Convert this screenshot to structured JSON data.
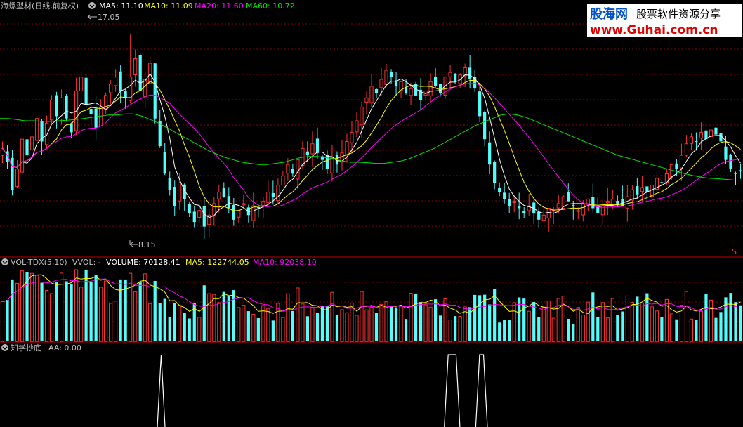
{
  "colors": {
    "up": "#ff3232",
    "down": "#54fcfc",
    "ma5": "#ffffff",
    "ma10": "#ffff00",
    "ma20": "#ff00ff",
    "ma60": "#00e600",
    "grid": "#8b0000",
    "text": "#c0c0c0",
    "aa": "#ffffff"
  },
  "price_panel": {
    "title": "海螺型材(日线,前复权)",
    "ma5_label": "MA5: 11.10",
    "ma10_label": "MA10: 11.09",
    "ma20_label": "MA20: 11.60",
    "ma60_label": "MA60: 10.72",
    "high_label": "17.05",
    "low_label": "8.15",
    "marker": "S"
  },
  "volume_panel": {
    "title": "VOL-TDX(5,10)",
    "vvol_label": "VVOL: -",
    "volume_label": "VOLUME: 70128.41",
    "ma5_label": "MA5: 122744.05",
    "ma10_label": "MA10: 92038.10"
  },
  "indicator_panel": {
    "title": "知学抄底",
    "aa_label": "AA: 0.00"
  },
  "watermark": {
    "brand_a": "股海网",
    "brand_b": "股票软件资源分享",
    "url": "www.Guhai.com.cn"
  },
  "chart_data": {
    "type": "candlestick",
    "price_range": [
      7.5,
      18.0
    ],
    "high": 17.05,
    "low": 8.15,
    "closes": [
      12.1,
      11.5,
      10.3,
      11.2,
      12.5,
      11.8,
      12.6,
      13.4,
      12.4,
      13.2,
      14.2,
      13.5,
      14.3,
      13.4,
      12.8,
      14.6,
      15.2,
      14.0,
      13.6,
      13.0,
      13.9,
      14.4,
      14.9,
      15.2,
      14.6,
      14.3,
      15.2,
      16.0,
      14.6,
      15.1,
      15.8,
      13.4,
      12.2,
      11.0,
      10.3,
      9.6,
      10.6,
      9.9,
      9.3,
      8.9,
      9.4,
      8.7,
      9.2,
      9.7,
      10.2,
      10.0,
      9.5,
      9.0,
      9.4,
      9.7,
      9.2,
      9.6,
      9.5,
      9.8,
      10.2,
      10.0,
      10.5,
      10.9,
      11.4,
      11.0,
      11.6,
      12.1,
      11.8,
      12.3,
      11.9,
      11.6,
      11.2,
      11.7,
      11.4,
      11.9,
      12.4,
      12.8,
      13.3,
      13.9,
      14.3,
      14.8,
      14.5,
      15.1,
      15.5,
      15.2,
      14.8,
      15.0,
      14.5,
      14.7,
      14.4,
      14.2,
      14.6,
      15.0,
      14.8,
      14.5,
      15.2,
      15.4,
      15.0,
      15.3,
      15.6,
      15.1,
      14.7,
      13.5,
      12.5,
      11.4,
      10.6,
      10.2,
      9.9,
      9.6,
      9.8,
      9.5,
      9.3,
      9.6,
      9.3,
      9.0,
      9.2,
      9.5,
      9.4,
      9.7,
      10.0,
      9.8,
      9.6,
      9.4,
      9.7,
      9.9,
      9.5,
      9.3,
      9.6,
      9.8,
      9.9,
      9.7,
      9.6,
      10.0,
      10.3,
      10.1,
      10.4,
      10.2,
      10.5,
      10.8,
      10.6,
      11.0,
      11.4,
      11.2,
      11.8,
      12.3,
      12.6,
      12.4,
      12.8,
      12.5,
      12.9,
      12.7,
      12.4,
      11.6,
      11.2,
      11.0,
      11.1
    ],
    "ma60": [
      13.4,
      13.4,
      13.35,
      13.3,
      13.3,
      13.28,
      13.27,
      13.3,
      13.32,
      13.35,
      13.4,
      13.45,
      13.5,
      13.55,
      13.55,
      13.6,
      13.6,
      13.5,
      13.35,
      13.2,
      13.0,
      12.8,
      12.6,
      12.4,
      12.2,
      12.0,
      11.85,
      11.7,
      11.6,
      11.5,
      11.45,
      11.4,
      11.4,
      11.45,
      11.5,
      11.6,
      11.7,
      11.75,
      11.75,
      11.7,
      11.65,
      11.55,
      11.5,
      11.5,
      11.48,
      11.45,
      11.45,
      11.5,
      11.55,
      11.65,
      11.8,
      11.95,
      12.1,
      12.3,
      12.5,
      12.7,
      12.9,
      13.1,
      13.25,
      13.4,
      13.55,
      13.6,
      13.55,
      13.45,
      13.3,
      13.15,
      13.0,
      12.85,
      12.7,
      12.55,
      12.4,
      12.25,
      12.1,
      11.95,
      11.8,
      11.7,
      11.6,
      11.5,
      11.4,
      11.3,
      11.2,
      11.1,
      11.0,
      10.92,
      10.85,
      10.8,
      10.78,
      10.75,
      10.72,
      10.72
    ],
    "aa_signals": [
      0,
      0,
      0,
      0,
      0,
      0,
      0,
      0,
      0,
      0,
      0,
      0,
      0,
      0,
      0,
      0,
      0,
      0,
      0,
      0,
      0,
      0,
      0,
      0,
      0,
      0,
      0,
      0,
      0,
      0,
      0,
      0,
      0,
      0,
      0,
      0,
      0,
      0,
      0,
      0,
      0,
      1,
      0,
      0,
      0,
      0,
      0,
      0,
      0,
      0,
      0,
      0,
      0,
      0,
      0,
      0,
      0,
      0,
      0,
      0,
      0,
      0,
      0,
      0,
      0,
      0,
      0,
      0,
      0,
      0,
      0,
      0,
      0,
      0,
      0,
      0,
      0,
      0,
      0,
      0,
      0,
      0,
      0,
      0,
      0,
      0,
      0,
      0,
      0,
      0,
      0,
      0,
      0,
      0,
      0,
      0,
      0,
      0,
      0,
      0,
      0,
      0,
      0,
      0,
      0,
      0,
      0,
      0,
      0,
      0,
      0,
      0,
      0,
      0,
      1,
      1,
      1,
      0,
      0,
      0,
      0,
      0,
      1,
      1,
      0,
      0,
      0,
      0,
      0,
      0,
      0,
      0,
      0,
      0,
      0,
      0,
      0,
      0,
      0,
      0,
      0,
      0,
      0,
      0,
      0,
      0,
      0,
      0,
      0,
      0,
      0,
      0,
      0,
      0,
      0,
      0,
      0,
      0,
      0,
      0,
      0,
      0,
      0,
      0,
      0,
      0,
      0,
      0,
      0,
      0,
      0,
      0,
      0,
      0,
      0,
      0,
      0,
      0,
      0,
      0,
      0,
      0,
      0,
      0,
      0,
      0,
      0,
      0,
      0,
      0
    ]
  }
}
